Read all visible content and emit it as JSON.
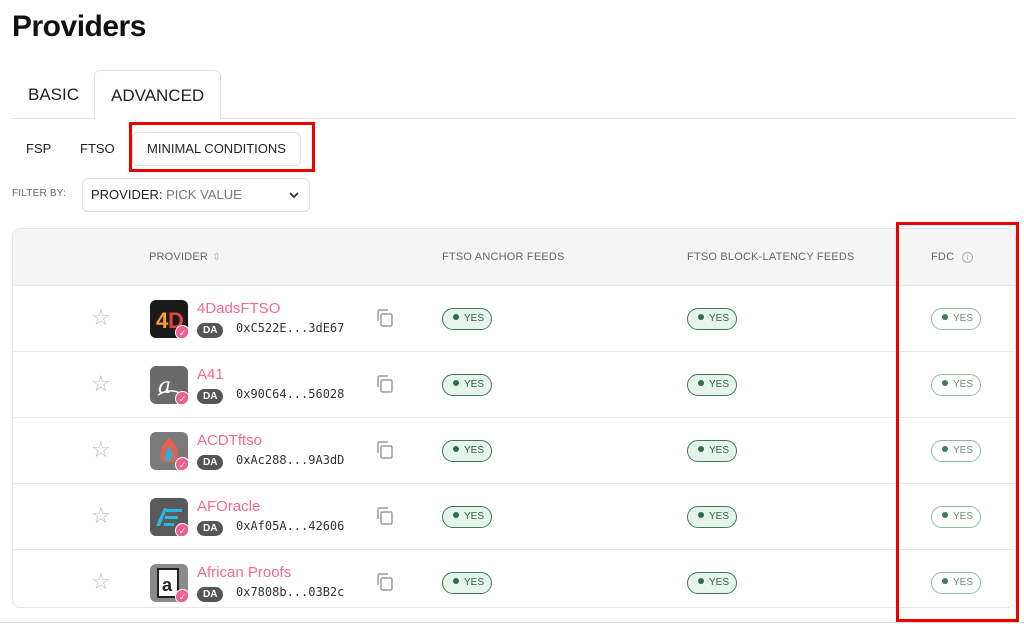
{
  "page": {
    "title": "Providers"
  },
  "main_tabs": [
    {
      "label": "BASIC"
    },
    {
      "label": "ADVANCED",
      "active": true
    }
  ],
  "sub_tabs": [
    {
      "label": "FSP"
    },
    {
      "label": "FTSO"
    },
    {
      "label": "MINIMAL CONDITIONS",
      "active": true
    }
  ],
  "filter": {
    "label": "FILTER BY:",
    "key": "PROVIDER:",
    "value": "PICK VALUE"
  },
  "table": {
    "columns": {
      "provider": "PROVIDER",
      "anchor": "FTSO ANCHOR FEEDS",
      "block_latency": "FTSO BLOCK-LATENCY FEEDS",
      "fdc": "FDC"
    },
    "rows": [
      {
        "name": "4DadsFTSO",
        "badge": "DA",
        "address": "0xC522E...3dE67",
        "anchor": "YES",
        "block_latency": "YES",
        "fdc": "YES",
        "logo_icon": "4d-logo-icon"
      },
      {
        "name": "A41",
        "badge": "DA",
        "address": "0x90C64...56028",
        "anchor": "YES",
        "block_latency": "YES",
        "fdc": "YES",
        "logo_icon": "a41-logo-icon"
      },
      {
        "name": "ACDTftso",
        "badge": "DA",
        "address": "0xAc288...9A3dD",
        "anchor": "YES",
        "block_latency": "YES",
        "fdc": "YES",
        "logo_icon": "flame-logo-icon"
      },
      {
        "name": "AFOracle",
        "badge": "DA",
        "address": "0xAf05A...42606",
        "anchor": "YES",
        "block_latency": "YES",
        "fdc": "YES",
        "logo_icon": "af-logo-icon"
      },
      {
        "name": "African Proofs",
        "badge": "DA",
        "address": "0x7808b...03B2c",
        "anchor": "YES",
        "block_latency": "YES",
        "fdc": "YES",
        "logo_icon": "a-box-logo-icon"
      }
    ]
  },
  "colors": {
    "highlight": "#ee0000",
    "provider_name": "#f26a8d",
    "badge_green": "#e6f5ec"
  }
}
